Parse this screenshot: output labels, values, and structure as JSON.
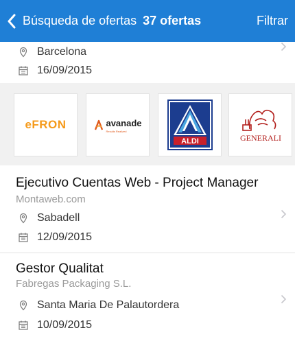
{
  "header": {
    "title": "Búsqueda de ofertas",
    "count": "37 ofertas",
    "filter_label": "Filtrar",
    "background_color": "#1f7fd6"
  },
  "previous_offer": {
    "location": "Barcelona",
    "date": "16/09/2015"
  },
  "companies": [
    {
      "name": "efron",
      "label": "eFRON"
    },
    {
      "name": "avanade",
      "label": "avanade",
      "tagline": "Results Realized"
    },
    {
      "name": "aldi",
      "label": "ALDI"
    },
    {
      "name": "generali",
      "label": "GENERALI"
    }
  ],
  "offers": [
    {
      "title": "Ejecutivo Cuentas Web - Project Manager",
      "company": "Montaweb.com",
      "location": "Sabadell",
      "date": "12/09/2015"
    },
    {
      "title": "Gestor Qualitat",
      "company": "Fabregas Packaging S.L.",
      "location": "Santa Maria De Palautordera",
      "date": "10/09/2015"
    }
  ],
  "icons": {
    "back": "chevron-left-icon",
    "location": "location-pin-icon",
    "date": "calendar-icon",
    "disclosure": "chevron-right-icon"
  }
}
